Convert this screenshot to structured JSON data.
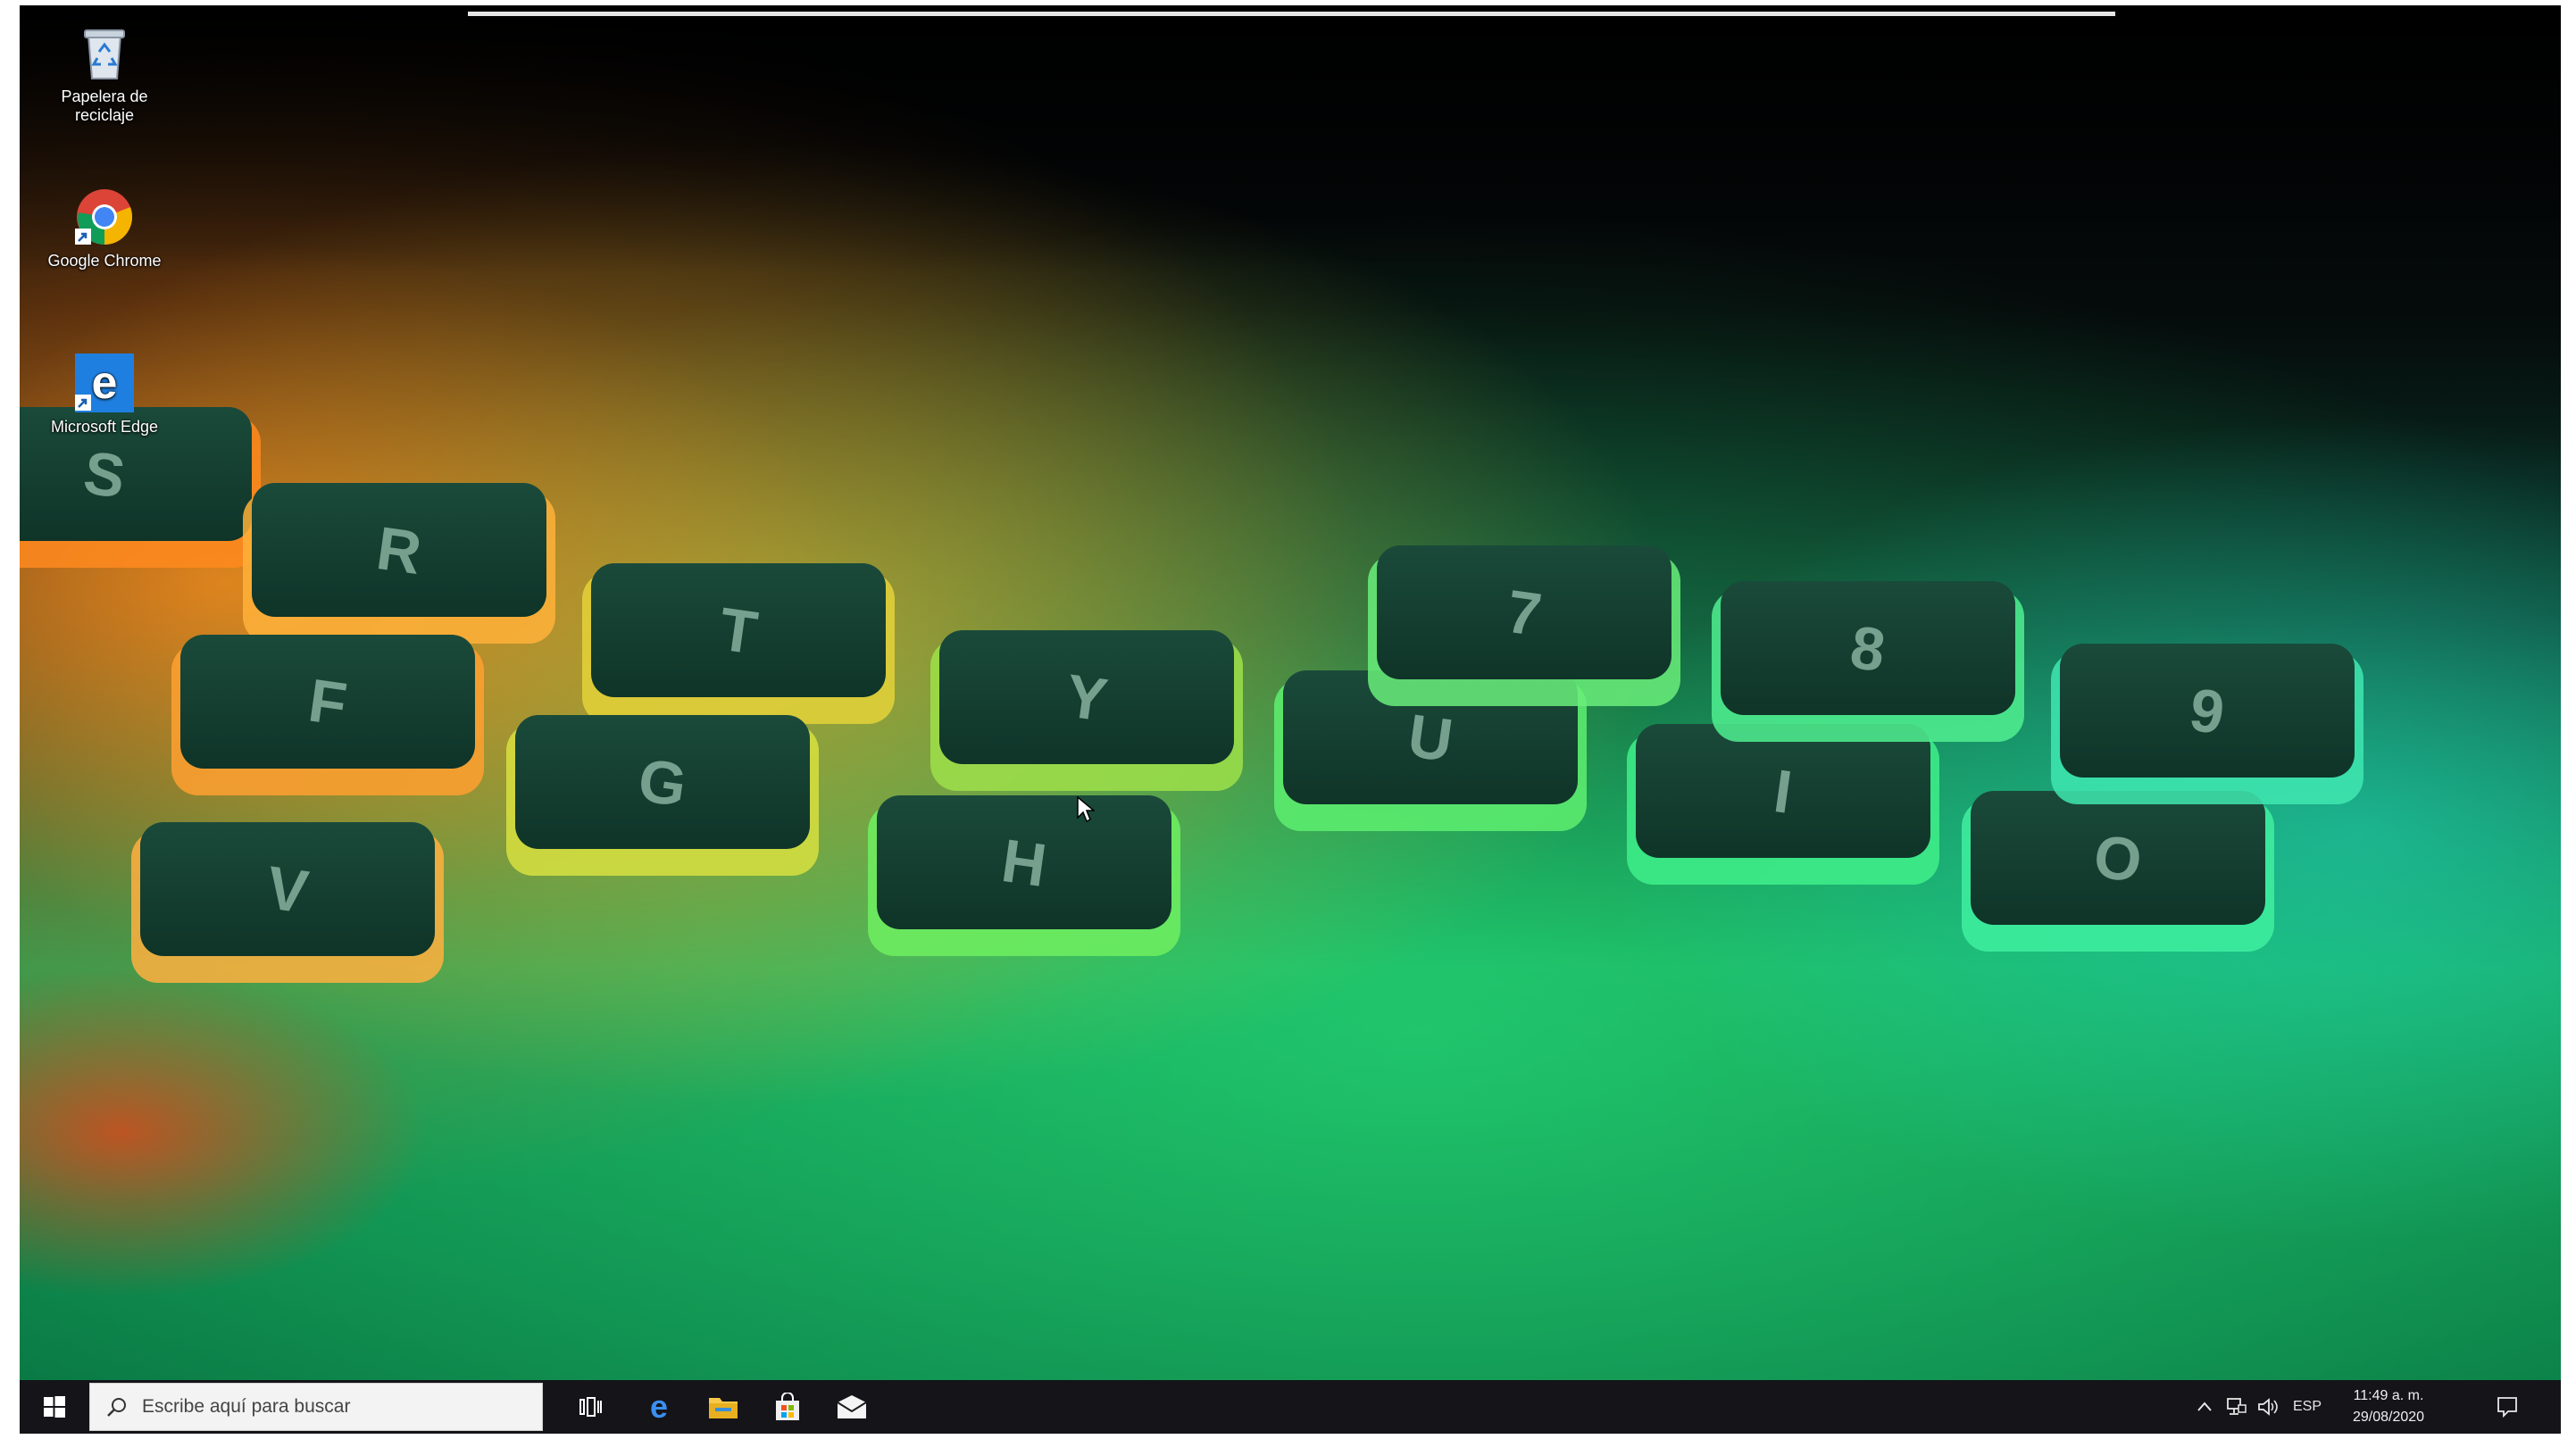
{
  "desktop": {
    "icons": [
      {
        "label": "Papelera de reciclaje",
        "icon": "recycle-bin-icon"
      },
      {
        "label": "Google Chrome",
        "icon": "chrome-icon"
      },
      {
        "label": "Microsoft Edge",
        "icon": "edge-icon"
      }
    ],
    "wallpaper": "rgb-backlit-keyboard",
    "keycaps": [
      "S",
      "R",
      "T",
      "Y",
      "U",
      "I",
      "O",
      "F",
      "G",
      "H",
      "V",
      "7",
      "8",
      "9"
    ]
  },
  "taskbar": {
    "start_icon": "windows-logo-icon",
    "search_placeholder": "Escribe aquí para buscar",
    "apps": [
      {
        "name": "Vista de tareas",
        "icon": "task-view-icon"
      },
      {
        "name": "Microsoft Edge",
        "icon": "edge-icon"
      },
      {
        "name": "Explorador de archivos",
        "icon": "file-explorer-icon"
      },
      {
        "name": "Microsoft Store",
        "icon": "store-icon"
      },
      {
        "name": "Correo",
        "icon": "mail-icon"
      }
    ],
    "tray": {
      "language": "ESP",
      "time": "11:49 a. m.",
      "date": "29/08/2020"
    }
  },
  "colors": {
    "taskbar_bg": "#141419",
    "accent_blue": "#0078d7",
    "keyboard_green": "#1ec46a",
    "keyboard_orange": "#ff8a1e"
  }
}
